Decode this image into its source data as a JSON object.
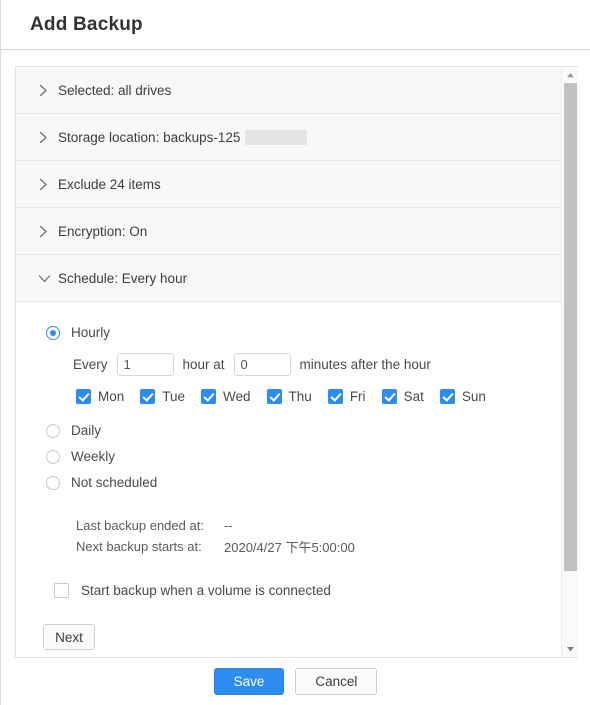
{
  "dialog": {
    "title": "Add Backup"
  },
  "accordion": {
    "items": [
      {
        "id": "selected",
        "label": "Selected: all drives",
        "icon": "chevron-right-icon",
        "expanded": false,
        "redacted": false
      },
      {
        "id": "storage-location",
        "label": "Storage location: backups-125",
        "icon": "chevron-right-icon",
        "expanded": false,
        "redacted": true
      },
      {
        "id": "exclude",
        "label": "Exclude 24 items",
        "icon": "chevron-right-icon",
        "expanded": false,
        "redacted": false
      },
      {
        "id": "encryption",
        "label": "Encryption: On",
        "icon": "chevron-right-icon",
        "expanded": false,
        "redacted": false
      },
      {
        "id": "schedule",
        "label": "Schedule: Every hour",
        "icon": "chevron-down-icon",
        "expanded": true,
        "redacted": false
      }
    ]
  },
  "schedule": {
    "options": [
      {
        "id": "hourly",
        "label": "Hourly",
        "selected": true
      },
      {
        "id": "daily",
        "label": "Daily",
        "selected": false
      },
      {
        "id": "weekly",
        "label": "Weekly",
        "selected": false
      },
      {
        "id": "not-scheduled",
        "label": "Not scheduled",
        "selected": false
      }
    ],
    "hourly": {
      "every_label": "Every",
      "hour_value": "1",
      "hour_at_label": "hour at",
      "minutes_value": "0",
      "minutes_suffix_label": "minutes after the hour"
    },
    "days": [
      {
        "id": "mon",
        "label": "Mon",
        "checked": true
      },
      {
        "id": "tue",
        "label": "Tue",
        "checked": true
      },
      {
        "id": "wed",
        "label": "Wed",
        "checked": true
      },
      {
        "id": "thu",
        "label": "Thu",
        "checked": true
      },
      {
        "id": "fri",
        "label": "Fri",
        "checked": true
      },
      {
        "id": "sat",
        "label": "Sat",
        "checked": true
      },
      {
        "id": "sun",
        "label": "Sun",
        "checked": true
      }
    ],
    "info": {
      "last_backup_label": "Last backup ended at:",
      "last_backup_value": "--",
      "next_backup_label": "Next backup starts at:",
      "next_backup_value": "2020/4/27 下午5:00:00"
    },
    "volume_checkbox": {
      "label": "Start backup when a volume is connected",
      "checked": false
    },
    "next_button_label": "Next"
  },
  "footer": {
    "save_label": "Save",
    "cancel_label": "Cancel"
  },
  "scrollbar": {
    "up_icon": "triangle-up-icon",
    "down_icon": "triangle-down-icon"
  },
  "colors": {
    "accent": "#2d8cf0",
    "row_bg": "#f8f8f8",
    "border": "#e6e6e6",
    "text": "#3d3d3d"
  }
}
